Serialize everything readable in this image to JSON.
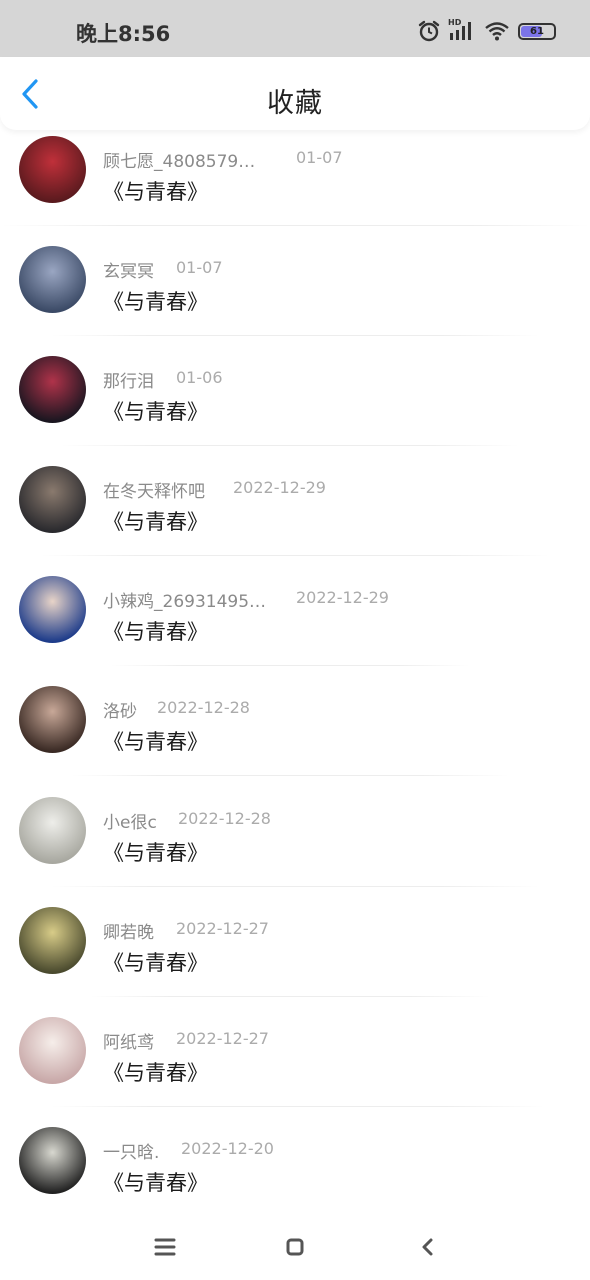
{
  "status_bar": {
    "time": "晚上8:56",
    "network_badge": "HD",
    "battery_percent": "61",
    "battery_level": 0.61,
    "icons": [
      "alarm-icon",
      "signal-icon",
      "wifi-icon",
      "battery-icon"
    ]
  },
  "header": {
    "title": "收藏",
    "back_icon": "chevron-left-icon"
  },
  "accent_color": "#2196f3",
  "items": [
    {
      "name": "顾七愿_4808579…",
      "date": "01-07",
      "title": "《与青春》",
      "avatar_colors": [
        "#5a1a1e",
        "#c0303a"
      ]
    },
    {
      "name": "玄冥冥",
      "date": "01-07",
      "title": "《与青春》",
      "avatar_colors": [
        "#3b4a66",
        "#9aa6c2"
      ]
    },
    {
      "name": "那行泪",
      "date": "01-06",
      "title": "《与青春》",
      "avatar_colors": [
        "#1a1620",
        "#b0334a"
      ]
    },
    {
      "name": "在冬天释怀吧",
      "date": "2022-12-29",
      "title": "《与青春》",
      "avatar_colors": [
        "#2a2a2e",
        "#8a7a6e"
      ]
    },
    {
      "name": "小辣鸡_26931495…",
      "date": "2022-12-29",
      "title": "《与青春》",
      "avatar_colors": [
        "#1e3c8a",
        "#e8d4c8"
      ]
    },
    {
      "name": "洛砂",
      "date": "2022-12-28",
      "title": "《与青春》",
      "avatar_colors": [
        "#3a2a24",
        "#c8a898"
      ]
    },
    {
      "name": "小e很c",
      "date": "2022-12-28",
      "title": "《与青春》",
      "avatar_colors": [
        "#a8a8a0",
        "#eeeeea"
      ]
    },
    {
      "name": "卿若晚",
      "date": "2022-12-27",
      "title": "《与青春》",
      "avatar_colors": [
        "#4a4a2e",
        "#d8cc88"
      ]
    },
    {
      "name": "阿纸鸢",
      "date": "2022-12-27",
      "title": "《与青春》",
      "avatar_colors": [
        "#c8a8a8",
        "#f6eeea"
      ]
    },
    {
      "name": "一只晗.",
      "date": "2022-12-20",
      "title": "《与青春》",
      "avatar_colors": [
        "#222222",
        "#d8d8d0"
      ]
    }
  ],
  "nav_bar": {
    "icons": [
      "menu-icon",
      "home-icon",
      "back-icon"
    ]
  }
}
